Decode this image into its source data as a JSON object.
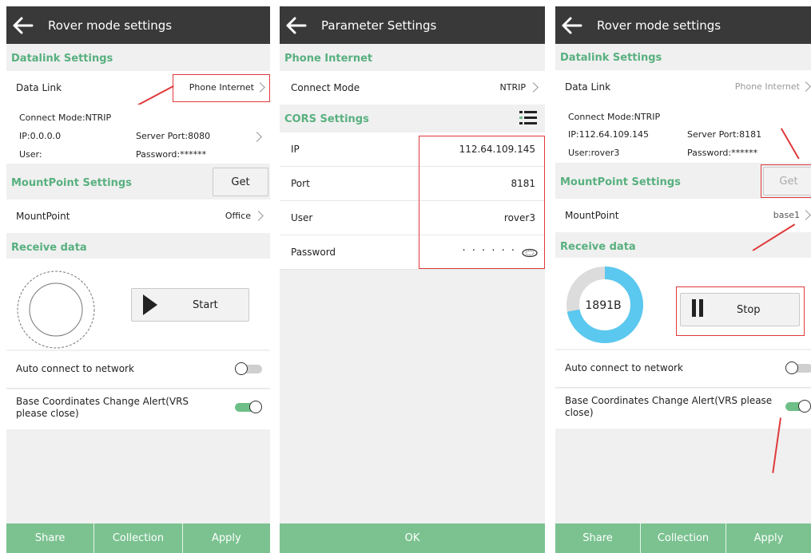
{
  "left": {
    "title": "Rover mode settings",
    "datalink_section": "Datalink Settings",
    "data_link_label": "Data Link",
    "data_link_value": "Phone Internet",
    "connect_mode": "Connect Mode:NTRIP",
    "ip": "IP:0.0.0.0",
    "server_port": "Server Port:8080",
    "user": "User:",
    "password": "Password:******",
    "mountpoint_section": "MountPoint Settings",
    "get_label": "Get",
    "mountpoint_label": "MountPoint",
    "mountpoint_value": "Office",
    "receive_section": "Receive data",
    "start_label": "Start",
    "auto_connect": "Auto connect to network",
    "auto_connect_on": false,
    "base_alert": "Base Coordinates Change Alert(VRS please close)",
    "base_alert_on": true,
    "share": "Share",
    "collection": "Collection",
    "apply": "Apply"
  },
  "middle": {
    "title": "Parameter Settings",
    "phone_section": "Phone Internet",
    "connect_mode_label": "Connect Mode",
    "connect_mode_value": "NTRIP",
    "cors_section": "CORS Settings",
    "list_icon": "list-icon",
    "ip_label": "IP",
    "ip_value": "112.64.109.145",
    "port_label": "Port",
    "port_value": "8181",
    "user_label": "User",
    "user_value": "rover3",
    "password_label": "Password",
    "password_value": "· · · · · ·",
    "ok": "OK"
  },
  "right": {
    "title": "Rover mode settings",
    "datalink_section": "Datalink Settings",
    "data_link_label": "Data Link",
    "data_link_value": "Phone Internet",
    "connect_mode": "Connect Mode:NTRIP",
    "ip": "IP:112.64.109.145",
    "server_port": "Server Port:8181",
    "user": "User:rover3",
    "password": "Password:******",
    "mountpoint_section": "MountPoint Settings",
    "get_label": "Get",
    "mountpoint_label": "MountPoint",
    "mountpoint_value": "base1",
    "receive_section": "Receive data",
    "received_bytes": "1891B",
    "ring_fraction": 0.72,
    "stop_label": "Stop",
    "auto_connect": "Auto connect to network",
    "auto_connect_on": false,
    "base_alert": "Base Coordinates Change Alert(VRS please close)",
    "base_alert_on": true,
    "share": "Share",
    "collection": "Collection",
    "apply": "Apply"
  },
  "colors": {
    "accent": "#58b07f",
    "button_green": "#7bc290",
    "header": "#393939",
    "ring": "#5bc8ef",
    "annotation": "#e0393b"
  }
}
